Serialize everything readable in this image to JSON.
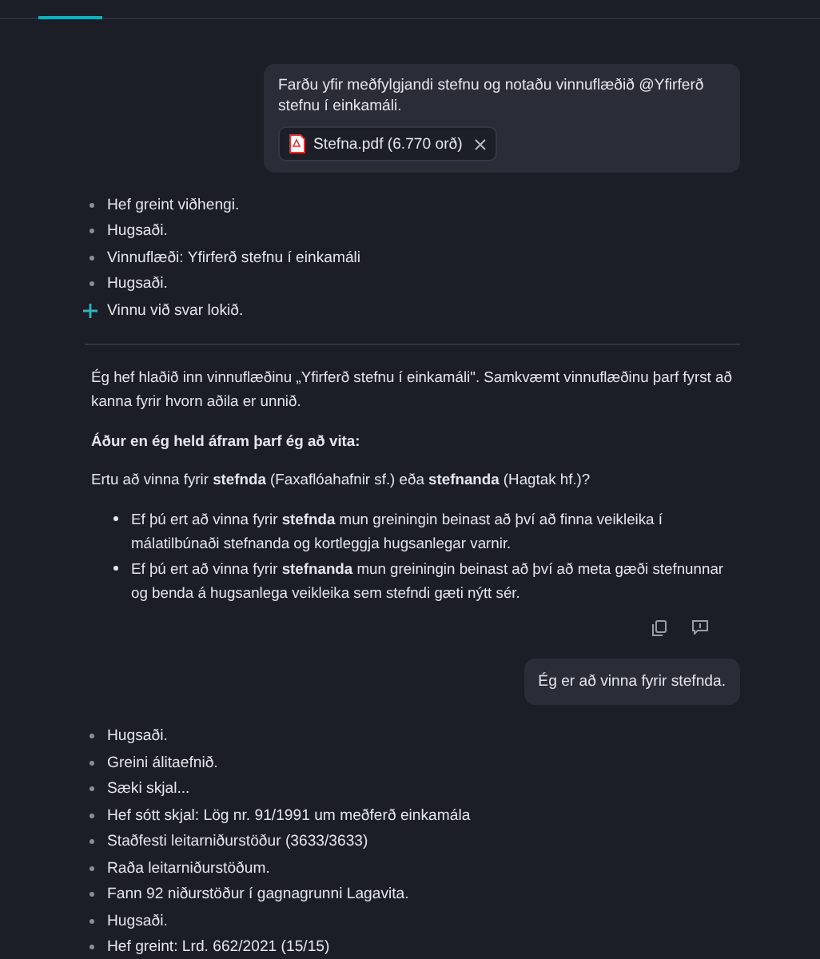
{
  "conversation": [
    {
      "kind": "user",
      "text": "Farðu yfir meðfylgjandi stefnu og notaðu vinnuflæðið @Yfirferð stefnu í einkamáli.",
      "attachment": "Stefna.pdf (6.770 orð)"
    },
    {
      "kind": "steps",
      "steps": [
        {
          "kind": "step",
          "text": "Hef greint viðhengi."
        },
        {
          "kind": "step",
          "text": "Hugsaði."
        },
        {
          "kind": "step",
          "text": "Vinnuflæði: Yfirferð stefnu í einkamáli"
        },
        {
          "kind": "step",
          "text": "Hugsaði."
        },
        {
          "kind": "done",
          "text": "Vinnu við svar lokið."
        }
      ]
    },
    {
      "kind": "assistant",
      "blocks": [
        {
          "kind": "paragraph",
          "text": "Ég hef hlaðið inn vinnuflæðinu „Yfirferð stefnu í einkamáli\". Samkvæmt vinnuflæðinu þarf fyrst að kanna fyrir hvorn aðila er unnið."
        },
        {
          "kind": "heading",
          "text": "Áður en ég held áfram þarf ég að vita:"
        },
        {
          "kind": "paragraph",
          "text": "Ertu að vinna fyrir **stefnda** (Faxaflóahafnir sf.) eða **stefnanda** (Hagtak hf.)?"
        },
        {
          "kind": "list",
          "items": [
            "Ef þú ert að vinna fyrir **stefnda** mun greiningin beinast að því að finna veikleika í málatilbúnaði stefnanda og kortleggja hugsanlegar varnir.",
            "Ef þú ert að vinna fyrir **stefnanda** mun greiningin beinast að því að meta gæði stefnunnar og benda á hugsanlega veikleika sem stefndi gæti nýtt sér."
          ]
        }
      ]
    },
    {
      "kind": "user",
      "text": "Ég er að vinna fyrir stefnda."
    },
    {
      "kind": "steps",
      "steps": [
        {
          "kind": "step",
          "text": "Hugsaði."
        },
        {
          "kind": "step",
          "text": "Greini álitaefnið."
        },
        {
          "kind": "step",
          "text": "Sæki skjal..."
        },
        {
          "kind": "step",
          "text": "Hef sótt skjal: Lög nr. 91/1991 um meðferð einkamála"
        },
        {
          "kind": "step",
          "text": "Staðfesti leitarniðurstöður (3633/3633)"
        },
        {
          "kind": "step",
          "text": "Raða leitarniðurstöðum."
        },
        {
          "kind": "step",
          "text": "Fann 92 niðurstöður í gagnagrunni Lagavita."
        },
        {
          "kind": "step",
          "text": "Hugsaði."
        },
        {
          "kind": "step",
          "text": "Hef greint: Lrd. 662/2021 (15/15)"
        }
      ]
    }
  ]
}
